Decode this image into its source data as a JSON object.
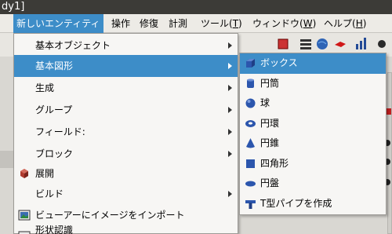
{
  "window": {
    "title_fragment": "dy1]"
  },
  "menubar": {
    "items": [
      {
        "label": "新しいエンティティ",
        "mnemonic": ""
      },
      {
        "label": "操作",
        "mnemonic": ""
      },
      {
        "label": "修復",
        "mnemonic": ""
      },
      {
        "label": "計測",
        "mnemonic": ""
      },
      {
        "label": "ツール(",
        "mnemonic": "T",
        "suffix": ")"
      },
      {
        "label": "ウィンドウ(",
        "mnemonic": "W",
        "suffix": ")"
      },
      {
        "label": "ヘルプ(",
        "mnemonic": "H",
        "suffix": ")"
      }
    ]
  },
  "menu": {
    "items": [
      {
        "label": "基本オブジェクト",
        "submenu": true,
        "icon": "none"
      },
      {
        "label": "基本図形",
        "submenu": true,
        "icon": "none",
        "selected": true
      },
      {
        "label": "生成",
        "submenu": true,
        "icon": "none"
      },
      {
        "label": "グループ",
        "submenu": true,
        "icon": "none"
      },
      {
        "label": "フィールド:",
        "submenu": true,
        "icon": "none"
      },
      {
        "label": "ブロック",
        "submenu": true,
        "icon": "none"
      },
      {
        "label": "展開",
        "submenu": false,
        "icon": "explode-icon"
      },
      {
        "label": "ビルド",
        "submenu": true,
        "icon": "none"
      },
      {
        "label": "ビューアーにイメージをインポート",
        "submenu": false,
        "icon": "image-import-icon"
      },
      {
        "label": "形状認識",
        "submenu": false,
        "icon": "shape-recognition-icon"
      }
    ]
  },
  "submenu": {
    "items": [
      {
        "label": "ボックス",
        "icon": "box-icon",
        "selected": true
      },
      {
        "label": "円筒",
        "icon": "cylinder-icon"
      },
      {
        "label": "球",
        "icon": "sphere-icon"
      },
      {
        "label": "円環",
        "icon": "torus-icon"
      },
      {
        "label": "円錐",
        "icon": "cone-icon"
      },
      {
        "label": "四角形",
        "icon": "rectangle-icon"
      },
      {
        "label": "円盤",
        "icon": "disk-icon"
      },
      {
        "label": "T型パイプを作成",
        "icon": "t-pipe-icon"
      }
    ]
  },
  "colors": {
    "highlight": "#3d8dc8",
    "menu_bg": "#f7f6f4",
    "titlebar": "#3c3b37",
    "menubar": "#edebe6"
  }
}
